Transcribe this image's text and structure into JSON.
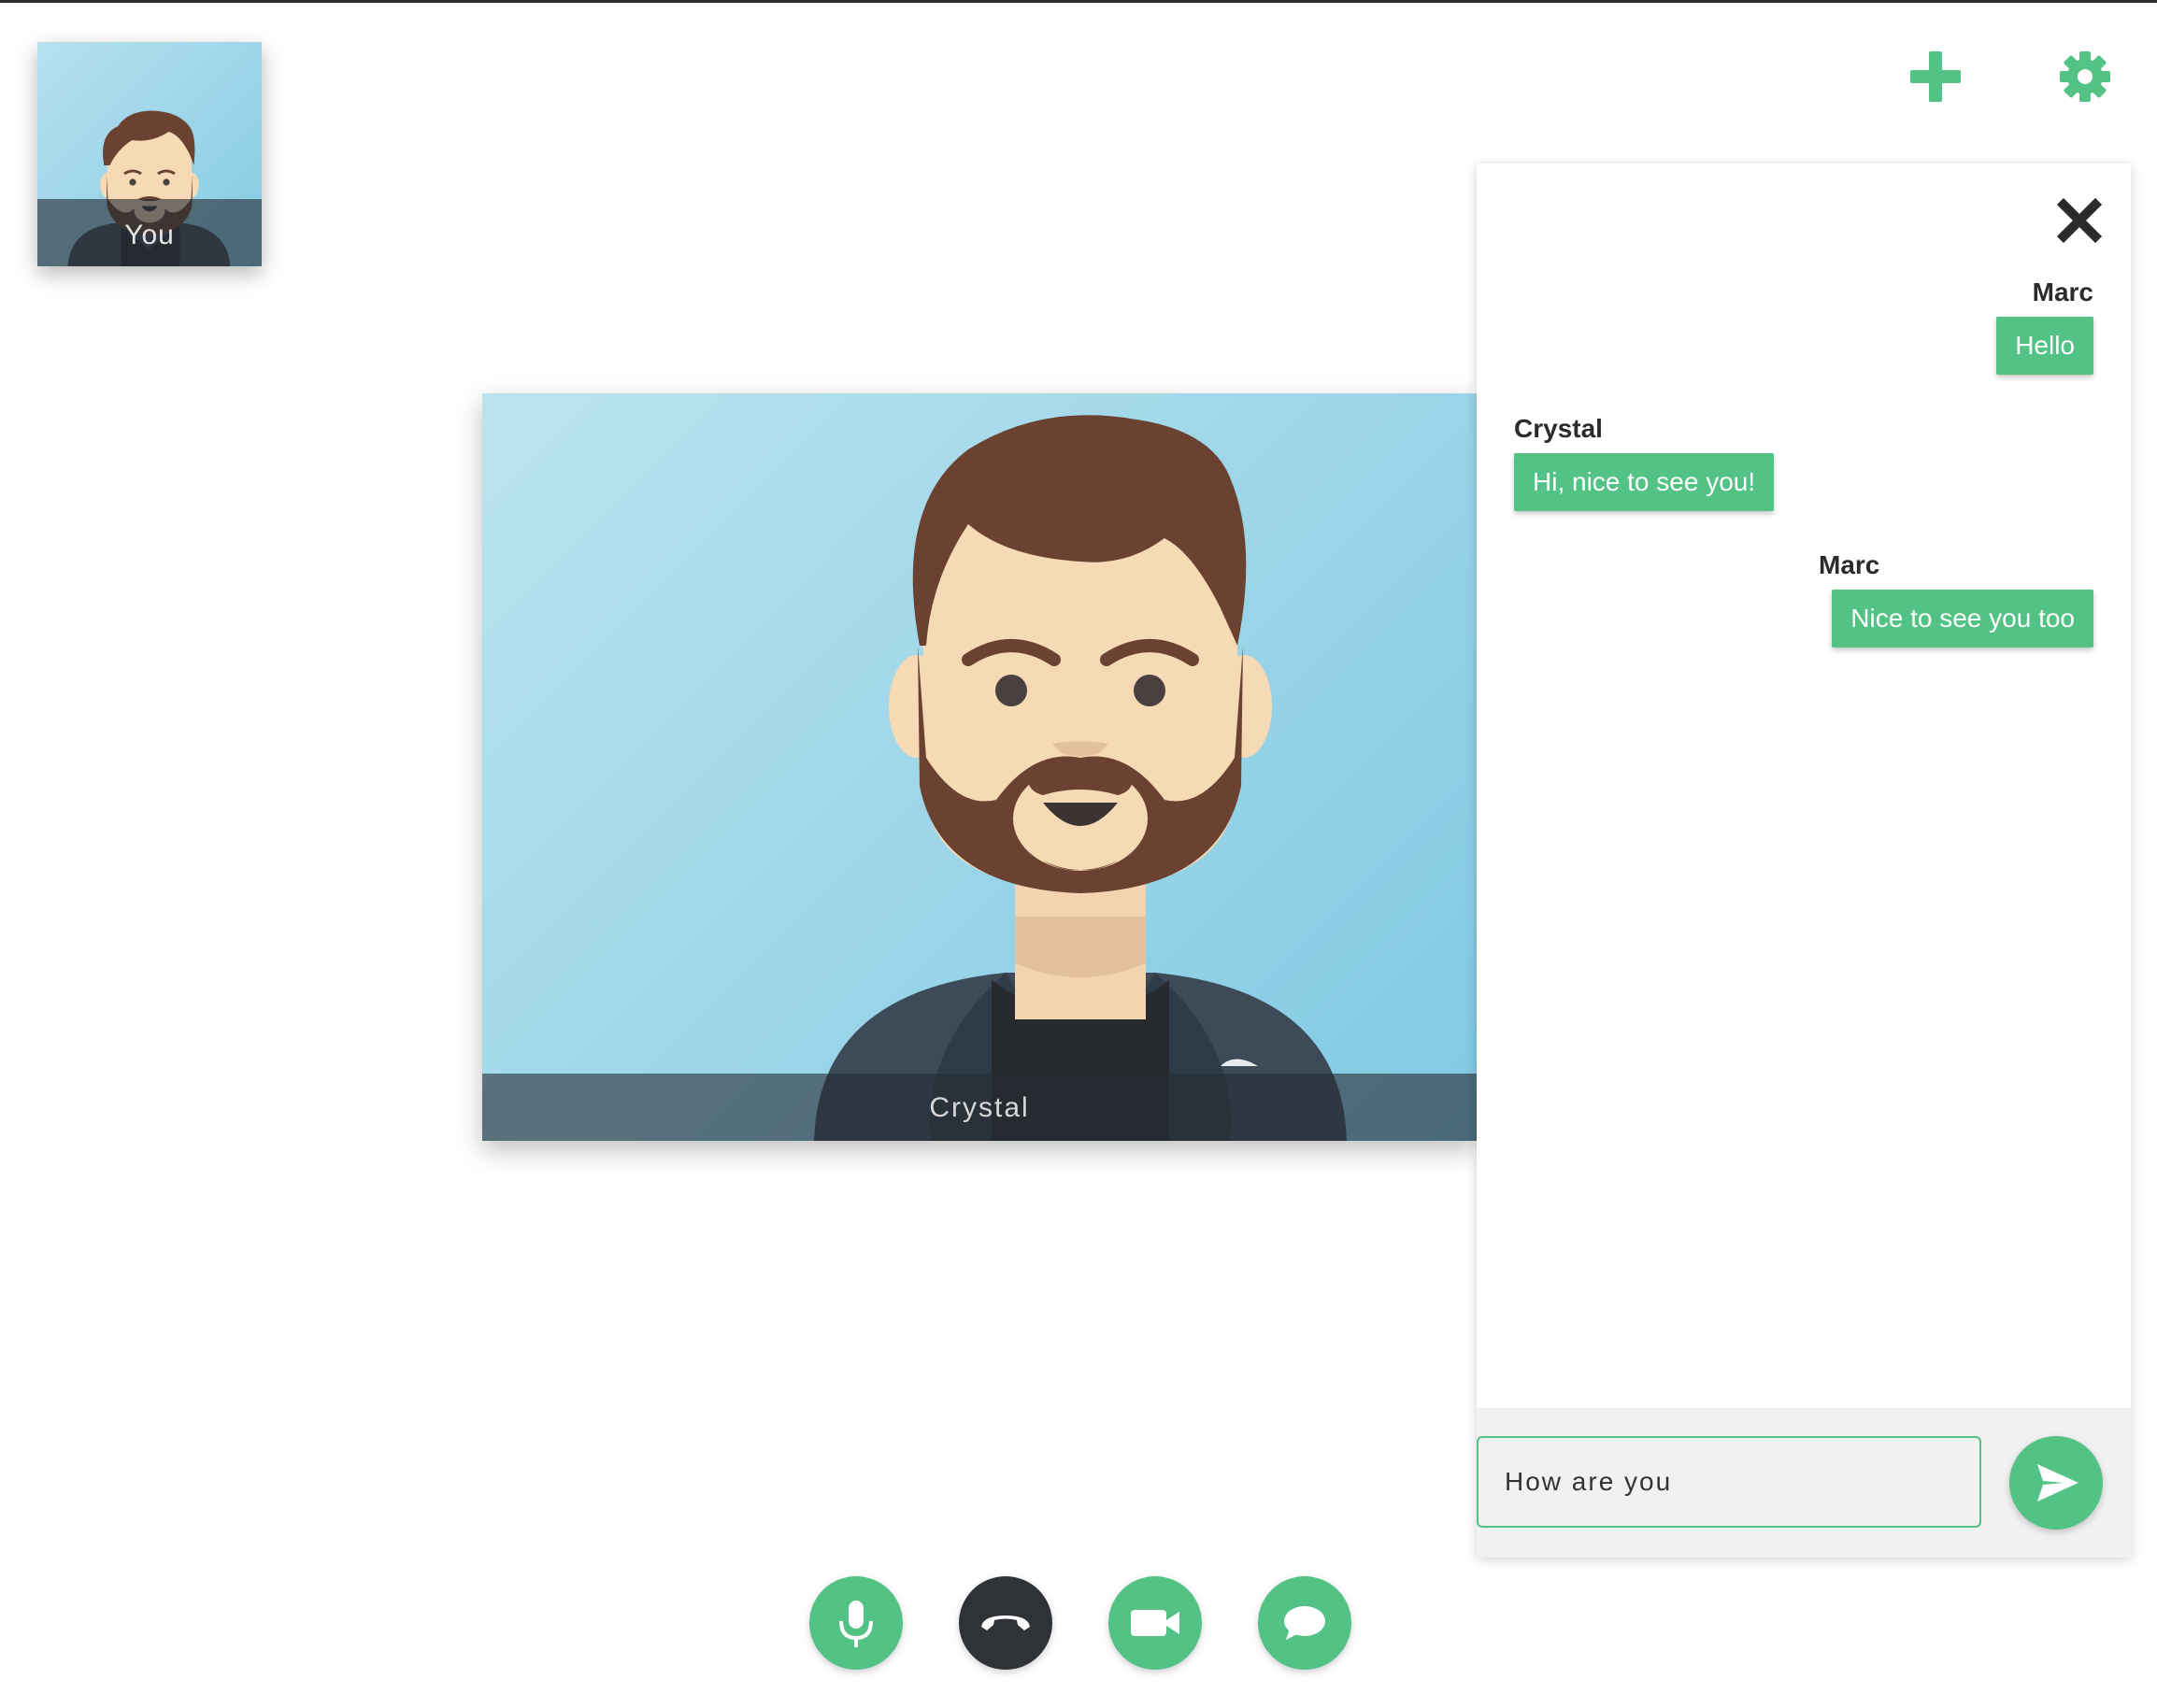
{
  "self_view": {
    "label": "You"
  },
  "remote_view": {
    "label": "Crystal"
  },
  "chat": {
    "messages": [
      {
        "sender": "Marc",
        "text": "Hello",
        "align": "right"
      },
      {
        "sender": "Crystal",
        "text": "Hi, nice to see you!",
        "align": "left"
      },
      {
        "sender": "Marc",
        "text": "Nice to see you too",
        "align": "right"
      }
    ],
    "input": {
      "value": "How are you"
    }
  },
  "icons": {
    "top_right": [
      "plus-icon",
      "gear-icon"
    ],
    "panel": [
      "close-icon",
      "send-icon"
    ],
    "controls": [
      "microphone-icon",
      "phone-hangup-icon",
      "video-camera-icon",
      "chat-bubble-icon"
    ]
  },
  "colors": {
    "accent": "#52c285",
    "hangup": "#2f3337",
    "video_bg": "#8fcfe6"
  }
}
